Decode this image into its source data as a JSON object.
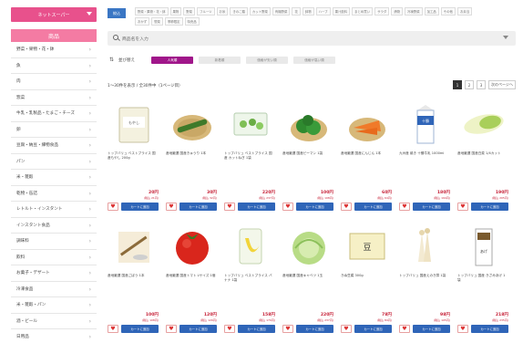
{
  "sidebar": {
    "store_select_label": "ネットスーパー",
    "category_header": "商品",
    "categories": [
      "野菜・果物・花・鉢",
      "魚",
      "肉",
      "惣菜",
      "牛乳・乳製品・たまご・チーズ",
      "卵",
      "豆腐・納豆・練物食品",
      "パン",
      "米・雑穀",
      "乾物・缶詰",
      "レトルト・インスタント",
      "インスタント食品",
      "調味料",
      "飲料",
      "お菓子・デザート",
      "冷凍食品",
      "米・雑穀・パン",
      "酒・ビール",
      "日用品"
    ]
  },
  "main": {
    "tag_button": "絞込",
    "tags": [
      "野菜・果物・花・鉢",
      "果物",
      "野菜",
      "フルーツ",
      "お米",
      "きのこ類",
      "カット野菜",
      "有機野菜",
      "花",
      "鉢物",
      "ハーブ",
      "果汁飲料",
      "まとめ買い",
      "サラダ",
      "漬物",
      "冷凍野菜",
      "加工品",
      "その他",
      "お弁当",
      "おかず",
      "惣菜",
      "季節限定",
      "特売品"
    ],
    "search_placeholder": "商品名を入力",
    "sort_label": "並び替え",
    "sort_options": [
      "人気順",
      "新着順",
      "価格が安い順",
      "価格が高い順"
    ],
    "result_text": "1〜30件を表示 / 全30件中（1ページ目）",
    "pagination": [
      "1",
      "2",
      "3",
      "次のページへ"
    ]
  },
  "products": [
    {
      "name": "トップバリュ ベストプライス 国産もやし 200g",
      "price": "20円",
      "tax": "(税込 21円)"
    },
    {
      "name": "産地厳選 国産きゅうり 1本",
      "price": "30円",
      "tax": "(税込 32円)"
    },
    {
      "name": "トップバリュ ベストプライス 国産 カットねぎ 1袋",
      "price": "220円",
      "tax": "(税込 237円)"
    },
    {
      "name": "産地厳選 国産ピーマン 1袋",
      "price": "100円",
      "tax": "(税込 108円)"
    },
    {
      "name": "産地厳選 国産にんじん 1本",
      "price": "60円",
      "tax": "(税込 64円)"
    },
    {
      "name": "九州産 焼き 十勝牛乳 1000ml",
      "price": "180円",
      "tax": "(税込 194円)"
    },
    {
      "name": "産地厳選 国産白菜 1/4カット",
      "price": "190円",
      "tax": "(税込 205円)"
    },
    {
      "name": "産地厳選 国産ごぼう 1本",
      "price": "100円",
      "tax": "(税込 108円)"
    },
    {
      "name": "産地厳選 国産トマト Lサイズ 1個",
      "price": "120円",
      "tax": "(税込 129円)"
    },
    {
      "name": "トップバリュ ベストプライス バナナ 1袋",
      "price": "158円",
      "tax": "(税込 170円)"
    },
    {
      "name": "産地厳選 国産キャベツ 1玉",
      "price": "220円",
      "tax": "(税込 237円)"
    },
    {
      "name": "きぬ豆腐 300g",
      "price": "78円",
      "tax": "(税込 84円)"
    },
    {
      "name": "トップバリュ 国産えのき茸 1袋",
      "price": "98円",
      "tax": "(税込 105円)"
    },
    {
      "name": "トップバリュ 国産 きざみあげ 1袋",
      "price": "218円",
      "tax": "(税込 235円)"
    }
  ],
  "product_icons": [
    "bean-sprouts-icon",
    "cucumber-icon",
    "cut-green-onion-icon",
    "green-pepper-icon",
    "carrot-icon",
    "milk-carton-icon",
    "napa-cabbage-icon",
    "burdock-icon",
    "tomato-icon",
    "banana-icon",
    "cabbage-icon",
    "tofu-icon",
    "enoki-mushroom-icon",
    "fried-tofu-icon"
  ],
  "cart_label": "カートに追加",
  "fav_glyph": "♥",
  "colors": {
    "brand_pink": "#e8518c",
    "category_pink": "#f47ba3",
    "sort_active": "#a0168a",
    "cart_blue": "#2f65b8",
    "price_red": "#c7243a",
    "tag_blue": "#3a76c4"
  }
}
